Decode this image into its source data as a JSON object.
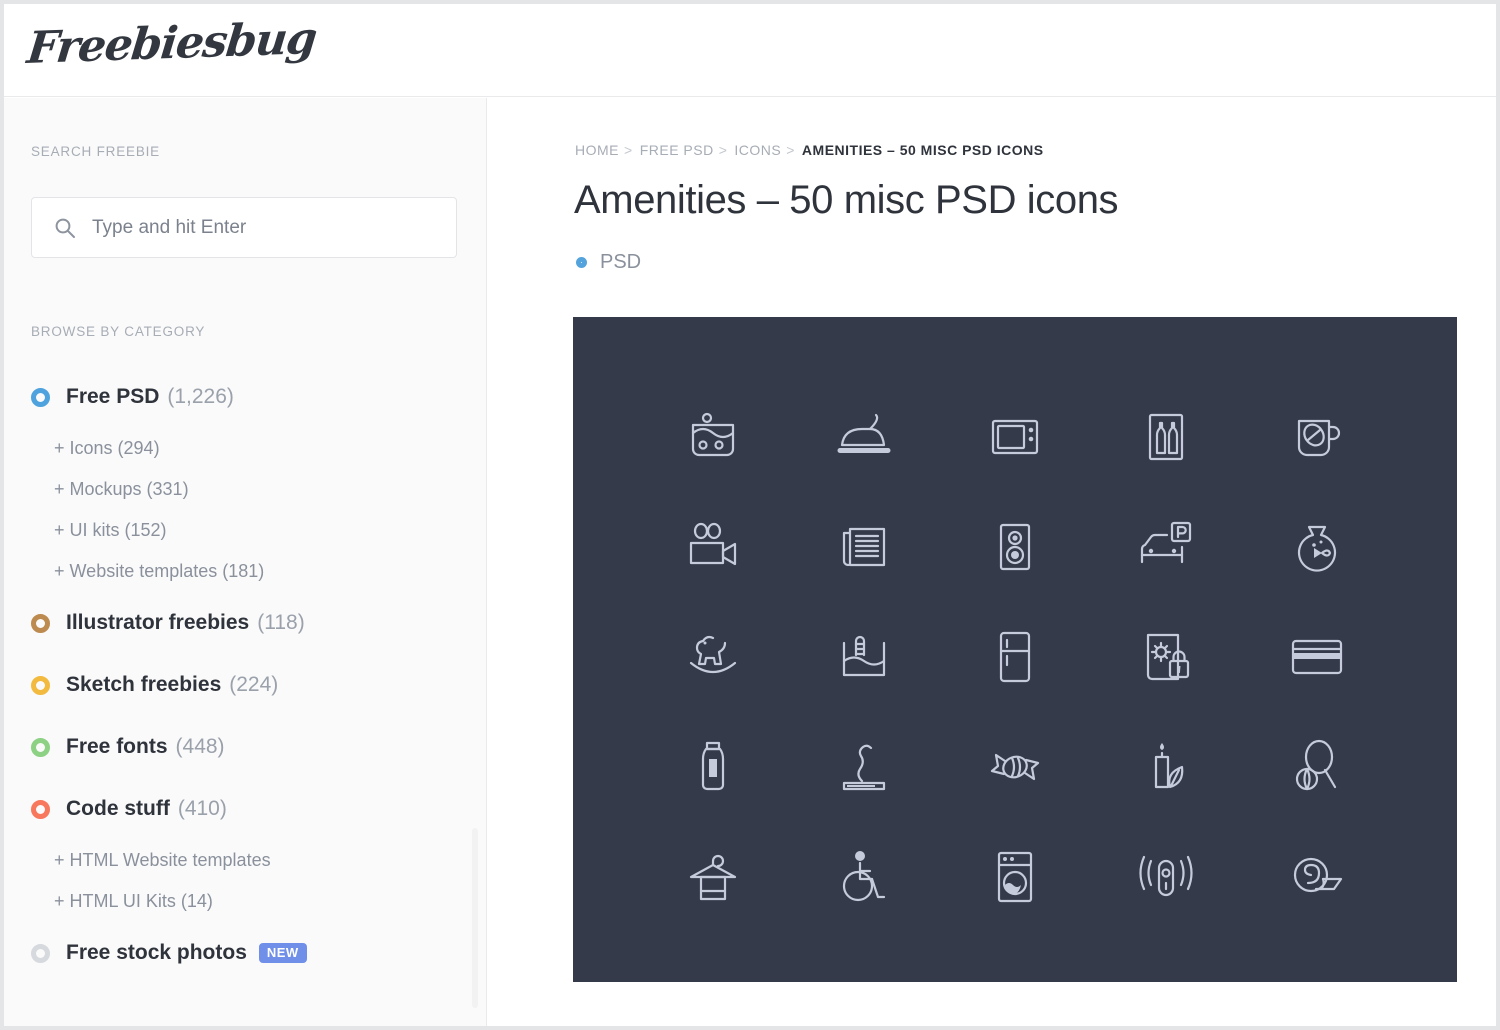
{
  "site": {
    "logo_text": "Freebiesbug"
  },
  "sidebar": {
    "search_section_label": "SEARCH FREEBIE",
    "search": {
      "icon": "search-icon",
      "value": "",
      "placeholder": "Type and hit Enter"
    },
    "browse_section_label": "BROWSE BY CATEGORY",
    "categories": [
      {
        "label": "Free PSD",
        "count": "(1,226)",
        "color": "#4ea3de",
        "children": [
          {
            "label": "+ Icons (294)"
          },
          {
            "label": "+ Mockups (331)"
          },
          {
            "label": "+ UI kits (152)"
          },
          {
            "label": "+ Website templates (181)"
          }
        ]
      },
      {
        "label": "Illustrator freebies",
        "count": "(118)",
        "color": "#bd8b4f",
        "children": []
      },
      {
        "label": "Sketch freebies",
        "count": "(224)",
        "color": "#f2bb3f",
        "children": []
      },
      {
        "label": "Free fonts",
        "count": "(448)",
        "color": "#8dd184",
        "children": []
      },
      {
        "label": "Code stuff",
        "count": "(410)",
        "color": "#f7785c",
        "children": [
          {
            "label": "+ HTML Website templates"
          },
          {
            "label": "+ HTML UI Kits (14)"
          }
        ]
      },
      {
        "label": "Free stock photos",
        "count": "",
        "color": "#d6d9dd",
        "badge": "NEW",
        "children": []
      }
    ]
  },
  "main": {
    "breadcrumb": [
      {
        "label": "HOME",
        "current": false
      },
      {
        "label": "FREE PSD",
        "current": false
      },
      {
        "label": "ICONS",
        "current": false
      },
      {
        "label": "AMENITIES – 50 MISC PSD ICONS",
        "current": true
      }
    ],
    "breadcrumb_separator": ">",
    "title": "Amenities – 50 misc PSD icons",
    "tag": {
      "label": "PSD",
      "color": "#55a3dd"
    },
    "showcase": {
      "background": "#353a4b",
      "icon_color": "#c5cbdb",
      "rows": 5,
      "columns": 5,
      "icons": [
        "laundry-tub-icon",
        "iron-icon",
        "microwave-icon",
        "minibar-bottles-icon",
        "coffee-cup-icon",
        "video-camera-icon",
        "newspaper-icon",
        "speaker-icon",
        "car-parking-icon",
        "fish-bowl-icon",
        "rocking-horse-icon",
        "swimming-pool-icon",
        "refrigerator-icon",
        "safe-lock-icon",
        "credit-card-icon",
        "water-bottle-icon",
        "cigarette-icon",
        "candy-icon",
        "aroma-candle-icon",
        "tennis-racket-icon",
        "hanger-towel-icon",
        "wheelchair-access-icon",
        "washing-machine-icon",
        "remote-signal-icon",
        "rolled-towel-icon"
      ]
    }
  },
  "colors": {
    "page_background": "#ffffff",
    "sidebar_background": "#fafafa",
    "border": "#e9eaec",
    "text_primary": "#2f333b",
    "text_muted": "#8a919c",
    "accent_blue": "#4ea3de",
    "badge_new": "#6f8fe8"
  }
}
